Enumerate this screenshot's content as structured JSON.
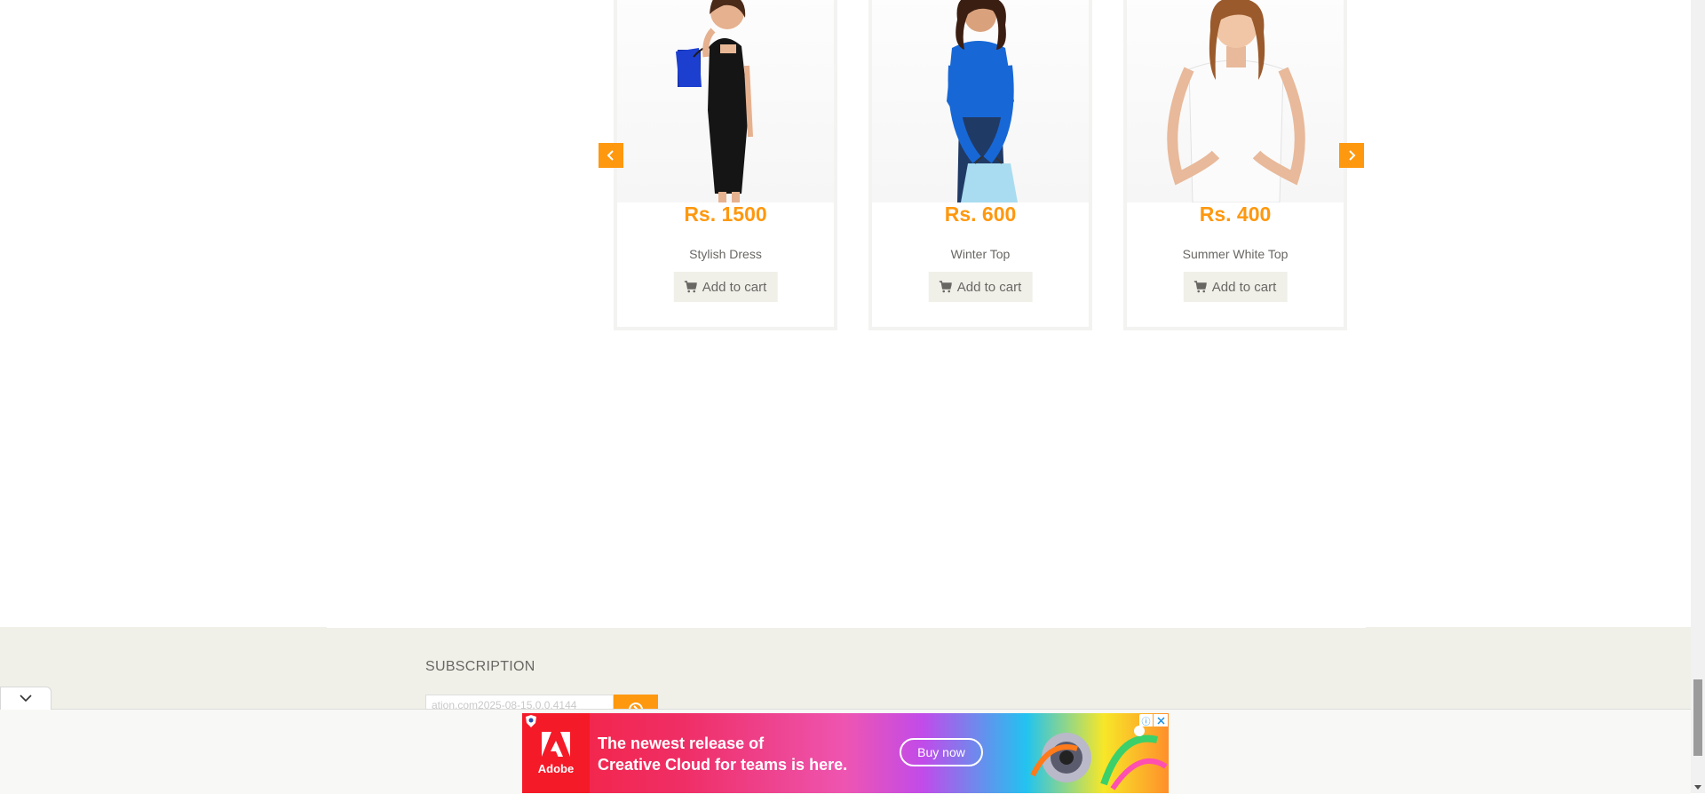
{
  "products": [
    {
      "price": "Rs. 1500",
      "name": "Stylish Dress",
      "cart_label": "Add to cart"
    },
    {
      "price": "Rs. 600",
      "name": "Winter Top",
      "cart_label": "Add to cart"
    },
    {
      "price": "Rs. 400",
      "name": "Summer White Top",
      "cart_label": "Add to cart"
    }
  ],
  "footer": {
    "subscription_title": "SUBSCRIPTION",
    "email_value": "ation.com2025-08-15.0.0.4144"
  },
  "ad": {
    "brand": "Adobe",
    "line1": "The newest release of",
    "line2": "Creative Cloud for teams is here.",
    "cta": "Buy now",
    "info_glyph": "ⓘ"
  },
  "colors": {
    "accent": "#fe980f",
    "text": "#696763",
    "footer_bg": "#f0f0e9",
    "adobe_red": "#f51a28"
  },
  "icons": {
    "prev": "chevron-left-icon",
    "next": "chevron-right-icon",
    "cart": "shopping-cart-icon",
    "subscribe": "circle-arrow-icon",
    "collapse": "chevron-down-icon",
    "ad_close": "close-icon",
    "ad_info": "info-icon"
  }
}
